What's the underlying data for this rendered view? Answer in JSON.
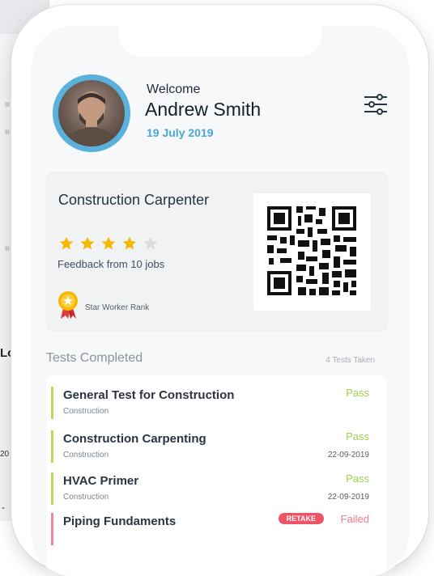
{
  "background": {
    "letter": "Lo",
    "small_text": "20",
    "dash": "-"
  },
  "header": {
    "welcome": "Welcome",
    "name": "Andrew Smith",
    "date": "19 July 2019"
  },
  "card": {
    "job_title": "Construction Carpenter",
    "rating": 4,
    "max_rating": 5,
    "feedback": "Feedback from 10 jobs",
    "rank": "Star Worker Rank"
  },
  "tests": {
    "heading": "Tests Completed",
    "count_label": "4 Tests Taken",
    "items": [
      {
        "name": "General Test for Construction",
        "category": "Construction",
        "status": "Pass",
        "date": ""
      },
      {
        "name": "Construction Carpenting",
        "category": "Construction",
        "status": "Pass",
        "date": "22-09-2019"
      },
      {
        "name": "HVAC Primer",
        "category": "Construction",
        "status": "Pass",
        "date": "22-09-2019"
      },
      {
        "name": "Piping Fundaments",
        "category": "",
        "status": "Failed",
        "date": "",
        "action": "RETAKE"
      }
    ]
  },
  "colors": {
    "accent_blue": "#4aa8d8",
    "pass_green": "#9dd24a",
    "fail_red": "#f07b89",
    "star_gold": "#f5b800",
    "star_empty": "#dcdcdc"
  }
}
